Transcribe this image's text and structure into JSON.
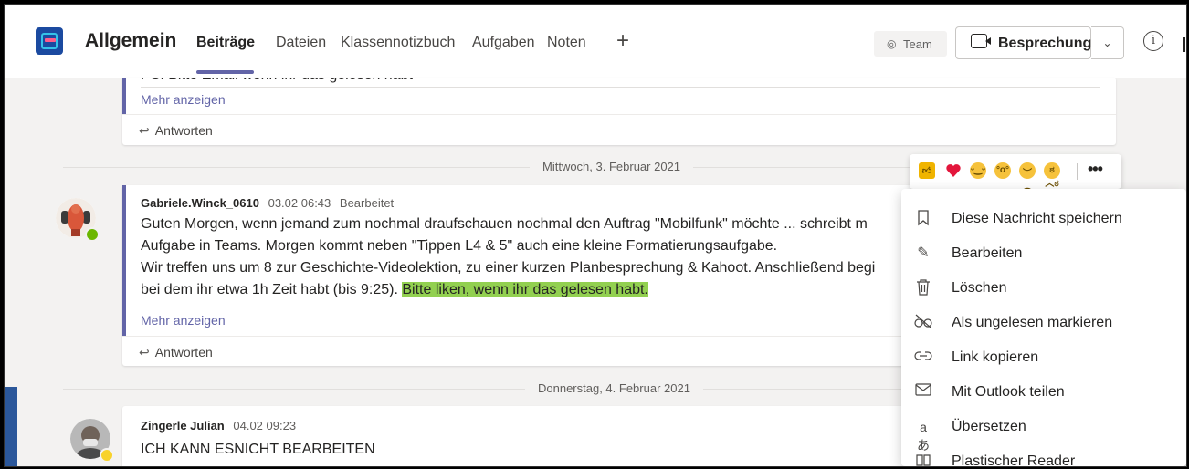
{
  "header": {
    "channel_title": "Allgemein",
    "tabs": [
      "Beiträge",
      "Dateien",
      "Klassennotizbuch",
      "Aufgaben",
      "Noten"
    ],
    "add_tab_symbol": "+",
    "team_label": "Team",
    "meet_label": "Besprechung",
    "info_symbol": "i"
  },
  "messages": {
    "prev": {
      "cut_text": "PS: Bitte Email wenn ihr das gelesen habt",
      "more": "Mehr anzeigen",
      "reply": "Antworten"
    },
    "date1": "Mittwoch, 3. Februar 2021",
    "m1": {
      "author": "Gabriele.Winck_0610",
      "time": "03.02 06:43",
      "edited": "Bearbeitet",
      "line1": "Guten Morgen, wenn jemand zum nochmal draufschauen nochmal den Auftrag \"Mobilfunk\" möchte ... schreibt m",
      "line2": "Aufgabe in Teams. Morgen kommt neben \"Tippen L4 & 5\" auch eine kleine Formatierungsaufgabe.",
      "line3": "Wir treffen uns um 8 zur Geschichte-Videolektion, zu einer kurzen Planbesprechung & Kahoot. Anschließend begi",
      "line4_plain": "bei dem ihr etwa 1h Zeit habt (bis 9:25). ",
      "line4_highlight": "Bitte liken, wenn ihr das gelesen habt.",
      "more": "Mehr anzeigen",
      "reply": "Antworten"
    },
    "date2": "Donnerstag, 4. Februar 2021",
    "m2": {
      "author": "Zingerle Julian",
      "time": "04.02 09:23",
      "text": "ICH KANN ESNICHT BEARBEITEN"
    }
  },
  "reactions": {
    "items": [
      "like",
      "heart",
      "laugh",
      "surprised",
      "sad",
      "angry"
    ],
    "more_symbol": "•••"
  },
  "context_menu": {
    "items": [
      {
        "icon": "bookmark-icon",
        "label": "Diese Nachricht speichern"
      },
      {
        "icon": "pencil-icon",
        "label": "Bearbeiten"
      },
      {
        "icon": "trash-icon",
        "label": "Löschen"
      },
      {
        "icon": "glasses-icon",
        "label": "Als ungelesen markieren"
      },
      {
        "icon": "link-icon",
        "label": "Link kopieren"
      },
      {
        "icon": "mail-icon",
        "label": "Mit Outlook teilen"
      },
      {
        "icon": "translate-icon",
        "label": "Übersetzen"
      },
      {
        "icon": "reader-icon",
        "label": "Plastischer Reader"
      }
    ]
  },
  "colors": {
    "accent": "#6264a7",
    "highlight": "#92d050",
    "presence_available": "#6bb700",
    "presence_away": "#f8d22a"
  }
}
